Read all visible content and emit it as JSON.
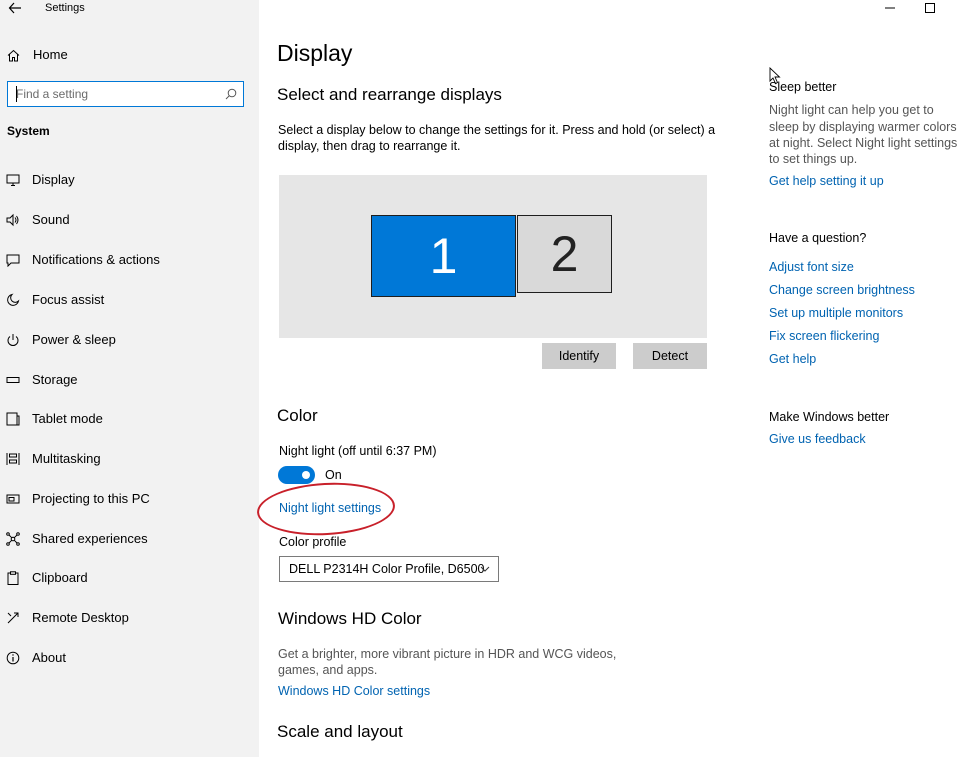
{
  "window": {
    "title": "Settings"
  },
  "sidebar": {
    "home_label": "Home",
    "search_placeholder": "Find a setting",
    "section_label": "System",
    "items": [
      {
        "label": "Display",
        "icon": "monitor-icon"
      },
      {
        "label": "Sound",
        "icon": "speaker-icon"
      },
      {
        "label": "Notifications & actions",
        "icon": "notification-icon"
      },
      {
        "label": "Focus assist",
        "icon": "moon-icon"
      },
      {
        "label": "Power & sleep",
        "icon": "power-icon"
      },
      {
        "label": "Storage",
        "icon": "storage-icon"
      },
      {
        "label": "Tablet mode",
        "icon": "tablet-icon"
      },
      {
        "label": "Multitasking",
        "icon": "multitasking-icon"
      },
      {
        "label": "Projecting to this PC",
        "icon": "projecting-icon"
      },
      {
        "label": "Shared experiences",
        "icon": "shared-icon"
      },
      {
        "label": "Clipboard",
        "icon": "clipboard-icon"
      },
      {
        "label": "Remote Desktop",
        "icon": "remote-desktop-icon"
      },
      {
        "label": "About",
        "icon": "info-icon"
      }
    ]
  },
  "main": {
    "title": "Display",
    "arrange_heading": "Select and rearrange displays",
    "arrange_desc_line1": "Select a display below to change the settings for it. Press and hold (or select) a",
    "arrange_desc_line2": "display, then drag to rearrange it.",
    "monitor1_label": "1",
    "monitor2_label": "2",
    "identify_label": "Identify",
    "detect_label": "Detect",
    "color_heading": "Color",
    "night_light_label": "Night light (off until 6:37 PM)",
    "toggle_state_label": "On",
    "night_light_settings_link": "Night light settings",
    "color_profile_label": "Color profile",
    "color_profile_value": "DELL P2314H Color Profile, D6500",
    "hd_color_heading": "Windows HD Color",
    "hd_color_desc_line1": "Get a brighter, more vibrant picture in HDR and WCG videos,",
    "hd_color_desc_line2": "games, and apps.",
    "hd_color_link": "Windows HD Color settings",
    "scale_heading": "Scale and layout"
  },
  "right_panel": {
    "sleep_heading": "Sleep better",
    "sleep_desc_lines": [
      "Night light can help you get to",
      "sleep by displaying warmer colors",
      "at night. Select Night light settings",
      "to set things up."
    ],
    "sleep_link": "Get help setting it up",
    "question_heading": "Have a question?",
    "help_links": [
      "Adjust font size",
      "Change screen brightness",
      "Set up multiple monitors",
      "Fix screen flickering",
      "Get help"
    ],
    "better_heading": "Make Windows better",
    "feedback_link": "Give us feedback"
  },
  "colors": {
    "accent": "#0078d7",
    "link": "#0063b1",
    "annotation": "#c8202a"
  }
}
